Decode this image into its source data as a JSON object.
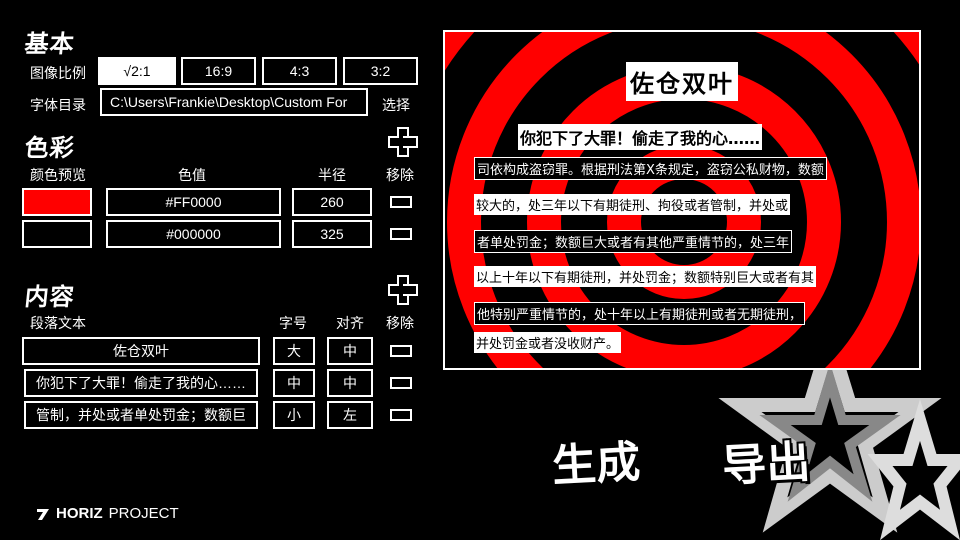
{
  "basic": {
    "title": "基本",
    "aspect_label": "图像比例",
    "aspect_options": [
      "√2:1",
      "16:9",
      "4:3",
      "3:2"
    ],
    "aspect_selected": "√2:1",
    "font_dir_label": "字体目录",
    "font_dir_value": "C:\\Users\\Frankie\\Desktop\\Custom For",
    "font_dir_button": "选择"
  },
  "colors": {
    "title": "色彩",
    "headers": {
      "preview": "颜色预览",
      "value": "色值",
      "radius": "半径",
      "remove": "移除"
    },
    "rows": [
      {
        "hex": "#FF0000",
        "radius": "260",
        "swatch": "#FF0000"
      },
      {
        "hex": "#000000",
        "radius": "325",
        "swatch": "#000000"
      }
    ]
  },
  "content": {
    "title": "内容",
    "headers": {
      "text": "段落文本",
      "size": "字号",
      "align": "对齐",
      "remove": "移除"
    },
    "rows": [
      {
        "text": "佐仓双叶",
        "size": "大",
        "align": "中"
      },
      {
        "text": "你犯下了大罪！偷走了我的心……",
        "size": "中",
        "align": "中"
      },
      {
        "text": "管制，并处或者单处罚金；数额巨",
        "size": "小",
        "align": "左"
      }
    ]
  },
  "preview": {
    "title": "佐仓双叶",
    "line1": "你犯下了大罪！偷走了我的心……",
    "lines": [
      "司依构成盗窃罪。根据刑法第X条规定，盗窃公私财物，数额",
      "较大的，处三年以下有期徒刑、拘役或者管制，并处或",
      "者单处罚金；数额巨大或者有其他严重情节的，处三年",
      "以上十年以下有期徒刑，并处罚金；数额特别巨大或者有其",
      "他特别严重情节的，处十年以上有期徒刑或者无期徒刑，",
      "并处罚金或者没收财产。"
    ],
    "colors": {
      "ring": "#FF0000",
      "bg": "#000000"
    }
  },
  "actions": {
    "generate": "生成",
    "export": "导出"
  },
  "brand": {
    "logo_bold": "HORIZ",
    "logo_rest": "PROJECT"
  }
}
